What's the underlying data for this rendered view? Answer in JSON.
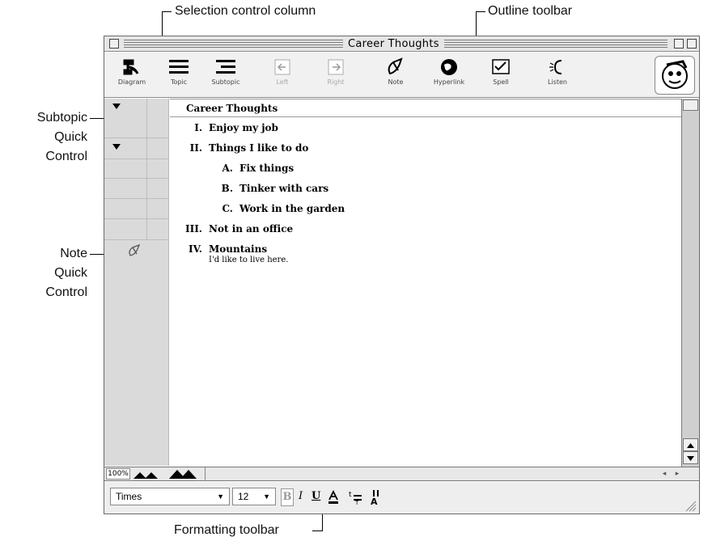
{
  "callouts": {
    "selection_column": "Selection control column",
    "outline_toolbar": "Outline toolbar",
    "subtopic_quick_control": [
      "Subtopic",
      "Quick",
      "Control"
    ],
    "note_quick_control": [
      "Note",
      "Quick",
      "Control"
    ],
    "formatting_toolbar": "Formatting toolbar"
  },
  "window": {
    "title": "Career Thoughts"
  },
  "toolbar": {
    "items": [
      {
        "label": "Diagram",
        "icon": "diagram-icon",
        "enabled": true
      },
      {
        "label": "Topic",
        "icon": "topic-icon",
        "enabled": true
      },
      {
        "label": "Subtopic",
        "icon": "subtopic-icon",
        "enabled": true
      },
      {
        "label": "Left",
        "icon": "left-arrow-icon",
        "enabled": false
      },
      {
        "label": "Right",
        "icon": "right-arrow-icon",
        "enabled": false
      },
      {
        "label": "Note",
        "icon": "note-icon",
        "enabled": true
      },
      {
        "label": "Hyperlink",
        "icon": "globe-icon",
        "enabled": true
      },
      {
        "label": "Spell",
        "icon": "spell-check-icon",
        "enabled": true
      },
      {
        "label": "Listen",
        "icon": "listen-icon",
        "enabled": true
      }
    ]
  },
  "outline": {
    "title": "Career Thoughts",
    "items": [
      {
        "number": "I.",
        "text": "Enjoy my job",
        "level": 1
      },
      {
        "number": "II.",
        "text": "Things I like to do",
        "level": 1
      },
      {
        "number": "A.",
        "text": "Fix things",
        "level": 2
      },
      {
        "number": "B.",
        "text": "Tinker with cars",
        "level": 2
      },
      {
        "number": "C.",
        "text": "Work in the garden",
        "level": 2
      },
      {
        "number": "III.",
        "text": "Not in an office",
        "level": 1
      },
      {
        "number": "IV.",
        "text": "Mountains",
        "level": 1,
        "note": "I'd like to live here."
      }
    ]
  },
  "statusbar": {
    "zoom": "100%"
  },
  "format": {
    "font": "Times",
    "size": "12",
    "bold": "B",
    "italic": "I",
    "underline": "U"
  },
  "colors": {
    "selection_column": "#dadada",
    "toolbar_bg": "#f1f1f1"
  }
}
